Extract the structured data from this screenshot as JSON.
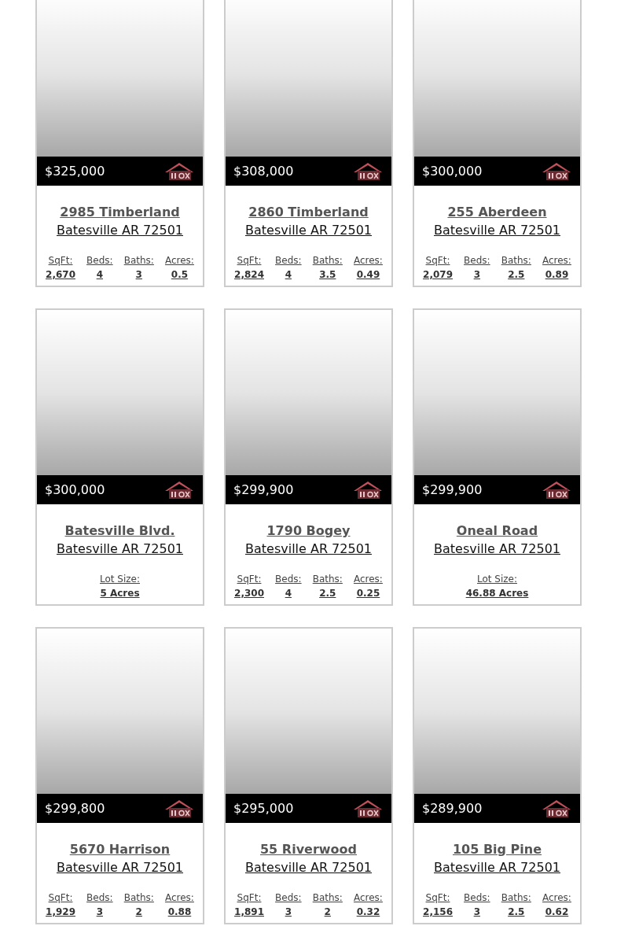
{
  "listings": [
    {
      "price": "$325,000",
      "address": "2985 Timberland",
      "city": "Batesville AR 72501",
      "stats": [
        {
          "label": "SqFt:",
          "value": "2,670"
        },
        {
          "label": "Beds:",
          "value": "4"
        },
        {
          "label": "Baths:",
          "value": "3"
        },
        {
          "label": "Acres:",
          "value": "0.5"
        }
      ]
    },
    {
      "price": "$308,000",
      "address": "2860 Timberland",
      "city": "Batesville AR 72501",
      "stats": [
        {
          "label": "SqFt:",
          "value": "2,824"
        },
        {
          "label": "Beds:",
          "value": "4"
        },
        {
          "label": "Baths:",
          "value": "3.5"
        },
        {
          "label": "Acres:",
          "value": "0.49"
        }
      ]
    },
    {
      "price": "$300,000",
      "address": "255 Aberdeen",
      "city": "Batesville AR 72501",
      "stats": [
        {
          "label": "SqFt:",
          "value": "2,079"
        },
        {
          "label": "Beds:",
          "value": "3"
        },
        {
          "label": "Baths:",
          "value": "2.5"
        },
        {
          "label": "Acres:",
          "value": "0.89"
        }
      ]
    },
    {
      "price": "$300,000",
      "address": "Batesville Blvd.",
      "city": "Batesville AR 72501",
      "stats": [
        {
          "label": "Lot Size:",
          "value": "5 Acres"
        }
      ]
    },
    {
      "price": "$299,900",
      "address": "1790 Bogey",
      "city": "Batesville AR 72501",
      "stats": [
        {
          "label": "SqFt:",
          "value": "2,300"
        },
        {
          "label": "Beds:",
          "value": "4"
        },
        {
          "label": "Baths:",
          "value": "2.5"
        },
        {
          "label": "Acres:",
          "value": "0.25"
        }
      ]
    },
    {
      "price": "$299,900",
      "address": "Oneal Road",
      "city": "Batesville AR 72501",
      "stats": [
        {
          "label": "Lot Size:",
          "value": "46.88 Acres"
        }
      ]
    },
    {
      "price": "$299,800",
      "address": "5670 Harrison",
      "city": "Batesville AR 72501",
      "stats": [
        {
          "label": "SqFt:",
          "value": "1,929"
        },
        {
          "label": "Beds:",
          "value": "3"
        },
        {
          "label": "Baths:",
          "value": "2"
        },
        {
          "label": "Acres:",
          "value": "0.88"
        }
      ]
    },
    {
      "price": "$295,000",
      "address": "55 Riverwood",
      "city": "Batesville AR 72501",
      "stats": [
        {
          "label": "SqFt:",
          "value": "1,891"
        },
        {
          "label": "Beds:",
          "value": "3"
        },
        {
          "label": "Baths:",
          "value": "2"
        },
        {
          "label": "Acres:",
          "value": "0.32"
        }
      ]
    },
    {
      "price": "$289,900",
      "address": "105 Big Pine",
      "city": "Batesville AR 72501",
      "stats": [
        {
          "label": "SqFt:",
          "value": "2,156"
        },
        {
          "label": "Beds:",
          "value": "3"
        },
        {
          "label": "Baths:",
          "value": "2.5"
        },
        {
          "label": "Acres:",
          "value": "0.62"
        }
      ]
    }
  ]
}
